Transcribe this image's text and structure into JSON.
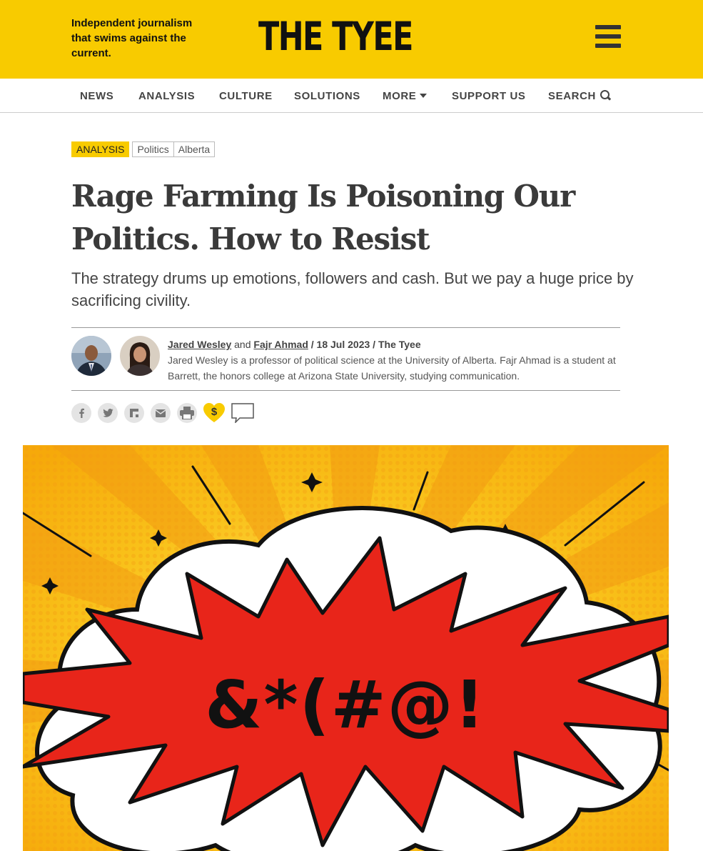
{
  "header": {
    "tagline": "Independent journalism that swims against the current.",
    "logo": "THE TYEE",
    "menu_icon": "hamburger-menu-icon",
    "brand_color": "#f8cb00"
  },
  "nav": {
    "items": [
      "NEWS",
      "ANALYSIS",
      "CULTURE",
      "SOLUTIONS",
      "MORE",
      "SUPPORT US",
      "SEARCH"
    ]
  },
  "article": {
    "tags": [
      "ANALYSIS",
      "Politics",
      "Alberta"
    ],
    "headline": "Rage Farming Is Poisoning Our Politics. How to Resist",
    "dek": "The strategy drums up emotions, followers and cash. But we pay a huge price by sacrificing civility.",
    "byline": {
      "author1": "Jared Wesley",
      "and": "and",
      "author2": "Fajr Ahmad",
      "date_sep": "/ 18 Jul 2023 /",
      "publisher": "The Tyee",
      "bio": "Jared Wesley is a professor of political science at the University of Alberta. Fajr Ahmad is a student at Barrett, the honors college at Arizona State University, studying communication."
    },
    "share": {
      "facebook": "facebook-icon",
      "twitter": "twitter-icon",
      "flipboard": "flipboard-icon",
      "email": "email-icon",
      "print": "print-icon",
      "support": "$",
      "comments": "comment-icon"
    },
    "hero_image": {
      "text": "&*(#@!"
    }
  }
}
